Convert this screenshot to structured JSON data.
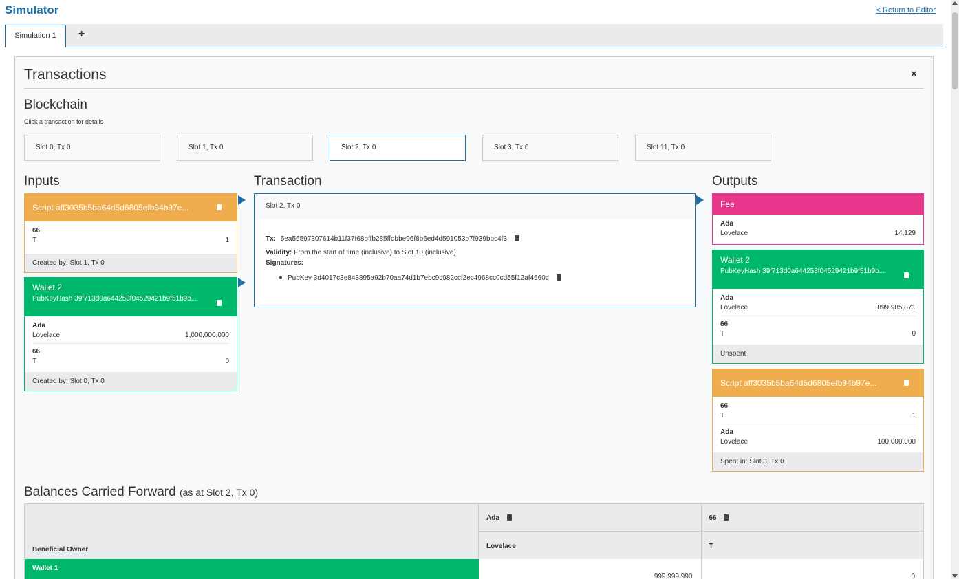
{
  "app": {
    "title": "Simulator",
    "return_link": "< Return to Editor"
  },
  "tabs": [
    {
      "label": "Simulation 1",
      "active": true
    }
  ],
  "tab_add_label": "+",
  "panel": {
    "title": "Transactions",
    "close_label": "×"
  },
  "blockchain": {
    "title": "Blockchain",
    "hint": "Click a transaction for details",
    "slots": [
      {
        "label": "Slot 0, Tx 0"
      },
      {
        "label": "Slot 1, Tx 0"
      },
      {
        "label": "Slot 2, Tx 0",
        "active": true
      },
      {
        "label": "Slot 3, Tx 0"
      },
      {
        "label": "Slot 11, Tx 0"
      }
    ]
  },
  "inputs": {
    "title": "Inputs",
    "cards": [
      {
        "header": "Script aff3035b5ba64d5d6805efb94b97e...",
        "assets": [
          {
            "name": "66",
            "rows": [
              {
                "label": "T",
                "value": "1"
              }
            ]
          }
        ],
        "footer": "Created by: Slot 1, Tx 0"
      },
      {
        "header": "Wallet 2",
        "subheader": "PubKeyHash 39f713d0a644253f04529421b9f51b9b...",
        "assets": [
          {
            "name": "Ada",
            "rows": [
              {
                "label": "Lovelace",
                "value": "1,000,000,000"
              }
            ]
          },
          {
            "name": "66",
            "rows": [
              {
                "label": "T",
                "value": "0"
              }
            ]
          }
        ],
        "footer": "Created by: Slot 0, Tx 0"
      }
    ]
  },
  "transaction": {
    "title": "Transaction",
    "header": "Slot 2, Tx 0",
    "tx_label": "Tx:",
    "tx_hash": "5ea56597307614b11f37f68bffb285ffdbbe96f8b6ed4d591053b7f939bbc4f3",
    "validity_label": "Validity:",
    "validity_value": "From the start of time (inclusive) to Slot 10 (inclusive)",
    "signatures_label": "Signatures:",
    "signatures": [
      "PubKey 3d4017c3e843895a92b70aa74d1b7ebc9c982ccf2ec4968cc0cd55f12af4660c"
    ]
  },
  "outputs": {
    "title": "Outputs",
    "cards": [
      {
        "header": "Fee",
        "assets": [
          {
            "name": "Ada",
            "rows": [
              {
                "label": "Lovelace",
                "value": "14,129"
              }
            ]
          }
        ]
      },
      {
        "header": "Wallet 2",
        "subheader": "PubKeyHash 39f713d0a644253f04529421b9f51b9b...",
        "assets": [
          {
            "name": "Ada",
            "rows": [
              {
                "label": "Lovelace",
                "value": "899,985,871"
              }
            ]
          },
          {
            "name": "66",
            "rows": [
              {
                "label": "T",
                "value": "0"
              }
            ]
          }
        ],
        "footer": "Unspent"
      },
      {
        "header": "Script aff3035b5ba64d5d6805efb94b97e...",
        "assets": [
          {
            "name": "66",
            "rows": [
              {
                "label": "T",
                "value": "1"
              }
            ]
          },
          {
            "name": "Ada",
            "rows": [
              {
                "label": "Lovelace",
                "value": "100,000,000"
              }
            ]
          }
        ],
        "footer": "Spent in: Slot 3, Tx 0"
      }
    ]
  },
  "balances": {
    "title": "Balances Carried Forward",
    "subtitle": "(as at Slot 2, Tx 0)",
    "owner_header": "Beneficial Owner",
    "columns": [
      {
        "symbol": "Ada",
        "token": "Lovelace"
      },
      {
        "symbol": "66",
        "token": "T"
      }
    ],
    "rows": [
      {
        "owner": "Wallet 1",
        "values": [
          "999,999,990",
          "0"
        ]
      }
    ]
  },
  "colors": {
    "accent": "#1f6fa8",
    "script": "#f0ad4e",
    "wallet": "#00b86b",
    "fee": "#e8368c"
  }
}
